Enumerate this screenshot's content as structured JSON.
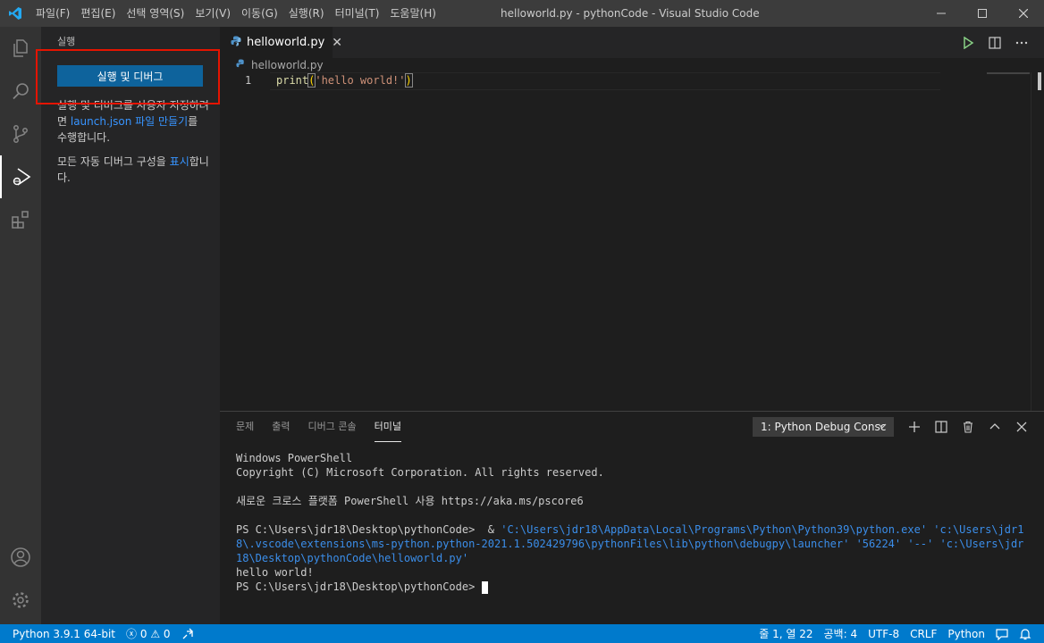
{
  "titlebar": {
    "menu": [
      "파일(F)",
      "편집(E)",
      "선택 영역(S)",
      "보기(V)",
      "이동(G)",
      "실행(R)",
      "터미널(T)",
      "도움말(H)"
    ],
    "window_title": "helloworld.py - pythonCode - Visual Studio Code"
  },
  "sidebar": {
    "title": "실행",
    "run_button": "실행 및 디버그",
    "text1_a": "실행 및 디버그를 사용자 지정하려면 ",
    "text1_link": "launch.json 파일 만들기",
    "text1_b": "를 수행합니다.",
    "text2_a": "모든 자동 디버그 구성을 ",
    "text2_link": "표시",
    "text2_b": "합니다."
  },
  "editor": {
    "tab_label": "helloworld.py",
    "breadcrumb": "helloworld.py",
    "line_number": "1",
    "code_func": "print",
    "code_paren_open": "(",
    "code_string": "'hello world!'",
    "code_paren_close": ")"
  },
  "panel": {
    "tabs": [
      "문제",
      "출력",
      "디버그 콘솔",
      "터미널"
    ],
    "active_tab": 3,
    "terminal_select": "1: Python Debug Consc",
    "terminal": {
      "l1": "Windows PowerShell",
      "l2": "Copyright (C) Microsoft Corporation. All rights reserved.",
      "l3": "새로운 크로스 플랫폼 PowerShell 사용 https://aka.ms/pscore6",
      "l4_prompt": "PS C:\\Users\\jdr18\\Desktop\\pythonCode>  & ",
      "l4_cmd": "'C:\\Users\\jdr18\\AppData\\Local\\Programs\\Python\\Python39\\python.exe' 'c:\\Users\\jdr18\\.vscode\\extensions\\ms-python.python-2021.1.502429796\\pythonFiles\\lib\\python\\debugpy\\launcher' '56224' '--' 'c:\\Users\\jdr18\\Desktop\\pythonCode\\helloworld.py'",
      "l5": "hello world!",
      "l6": "PS C:\\Users\\jdr18\\Desktop\\pythonCode> "
    }
  },
  "statusbar": {
    "python": "Python 3.9.1 64-bit",
    "errors": "0",
    "warnings": "0",
    "position": "줄 1, 열 22",
    "spaces": "공백: 4",
    "encoding": "UTF-8",
    "eol": "CRLF",
    "language": "Python"
  },
  "colors": {
    "accent": "#007acc",
    "button": "#0e639c",
    "highlight": "#e51400",
    "string": "#ce9178",
    "function": "#dcdcaa"
  }
}
